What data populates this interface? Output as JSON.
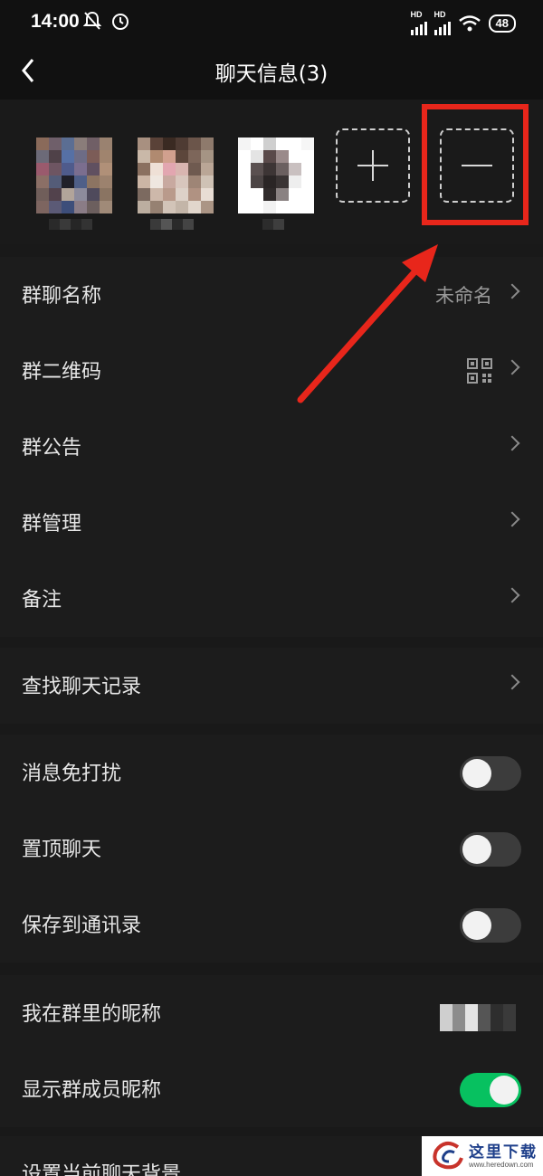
{
  "status_bar": {
    "time": "14:00",
    "network_1": "HD",
    "network_2": "HD",
    "battery": "48",
    "icons": [
      "mute-notification-icon",
      "alarm-icon",
      "signal-icon",
      "signal-icon",
      "wifi-icon",
      "battery-icon"
    ]
  },
  "header": {
    "title": "聊天信息(3)",
    "back_icon": "chevron-left-icon"
  },
  "members": {
    "add_icon": "plus-icon",
    "remove_icon": "minus-icon",
    "highlight_color": "#e8261b"
  },
  "settings": {
    "group_name": {
      "label": "群聊名称",
      "value": "未命名"
    },
    "qr_code": {
      "label": "群二维码",
      "icon": "qr-code-icon"
    },
    "announcement": {
      "label": "群公告"
    },
    "management": {
      "label": "群管理"
    },
    "remark": {
      "label": "备注"
    },
    "search_history": {
      "label": "查找聊天记录"
    },
    "mute": {
      "label": "消息免打扰",
      "enabled": false
    },
    "pin": {
      "label": "置顶聊天",
      "enabled": false
    },
    "save_contacts": {
      "label": "保存到通讯录",
      "enabled": false
    },
    "my_nickname": {
      "label": "我在群里的昵称"
    },
    "show_nicknames": {
      "label": "显示群成员昵称",
      "enabled": true
    },
    "background": {
      "label": "设置当前聊天背景"
    }
  },
  "watermark": {
    "text": "这里下载",
    "url": "www.heredown.com"
  },
  "colors": {
    "accent_green": "#07c160",
    "background": "#191919",
    "arrow_red": "#e8261b"
  }
}
